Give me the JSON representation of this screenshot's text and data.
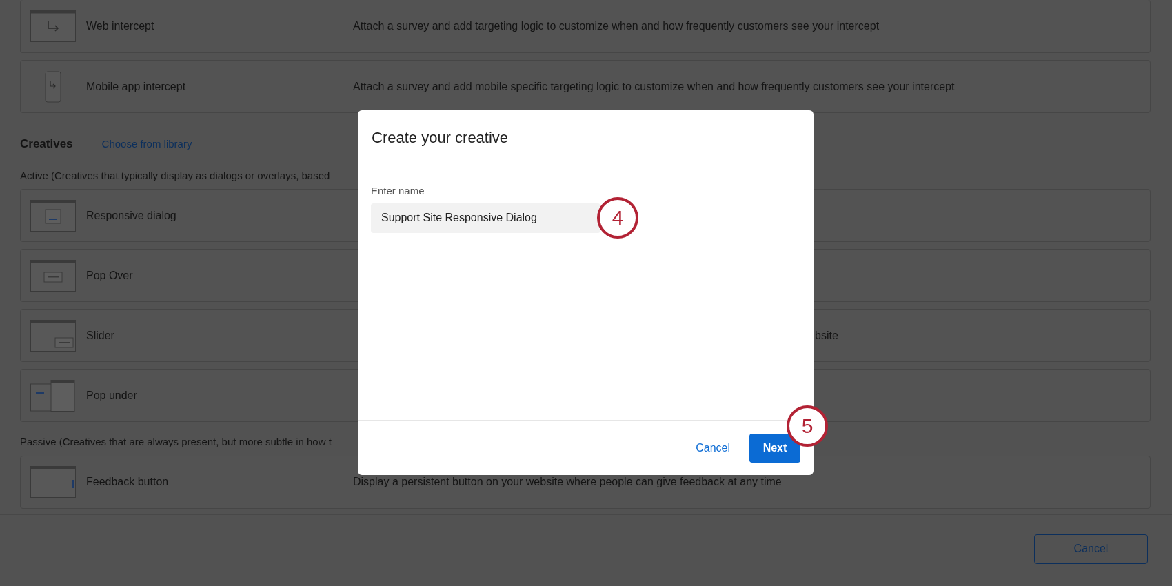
{
  "intercepts": [
    {
      "title": "Web intercept",
      "description": "Attach a survey and add targeting logic to customize when and how frequently customers see your intercept"
    },
    {
      "title": "Mobile app intercept",
      "description": "Attach a survey and add mobile specific targeting logic to customize when and how frequently customers see your intercept"
    }
  ],
  "creatives": {
    "heading": "Creatives",
    "link": "Choose from library",
    "active_note": "Active (Creatives that typically display as dialogs or overlays, based",
    "active": [
      {
        "title": "Responsive dialog"
      },
      {
        "title": "Pop Over"
      },
      {
        "title": "Slider",
        "description": "bsite"
      },
      {
        "title": "Pop under"
      }
    ],
    "passive_note": "Passive (Creatives that are always present, but more subtle in how t",
    "passive": [
      {
        "title": "Feedback button",
        "description": "Display a persistent button on your website where people can give feedback at any time"
      }
    ]
  },
  "footer": {
    "cancel": "Cancel"
  },
  "dialog": {
    "title": "Create your creative",
    "field_label": "Enter name",
    "value": "Support Site Responsive Dialog",
    "cancel": "Cancel",
    "next": "Next"
  },
  "badges": [
    "4",
    "5"
  ]
}
